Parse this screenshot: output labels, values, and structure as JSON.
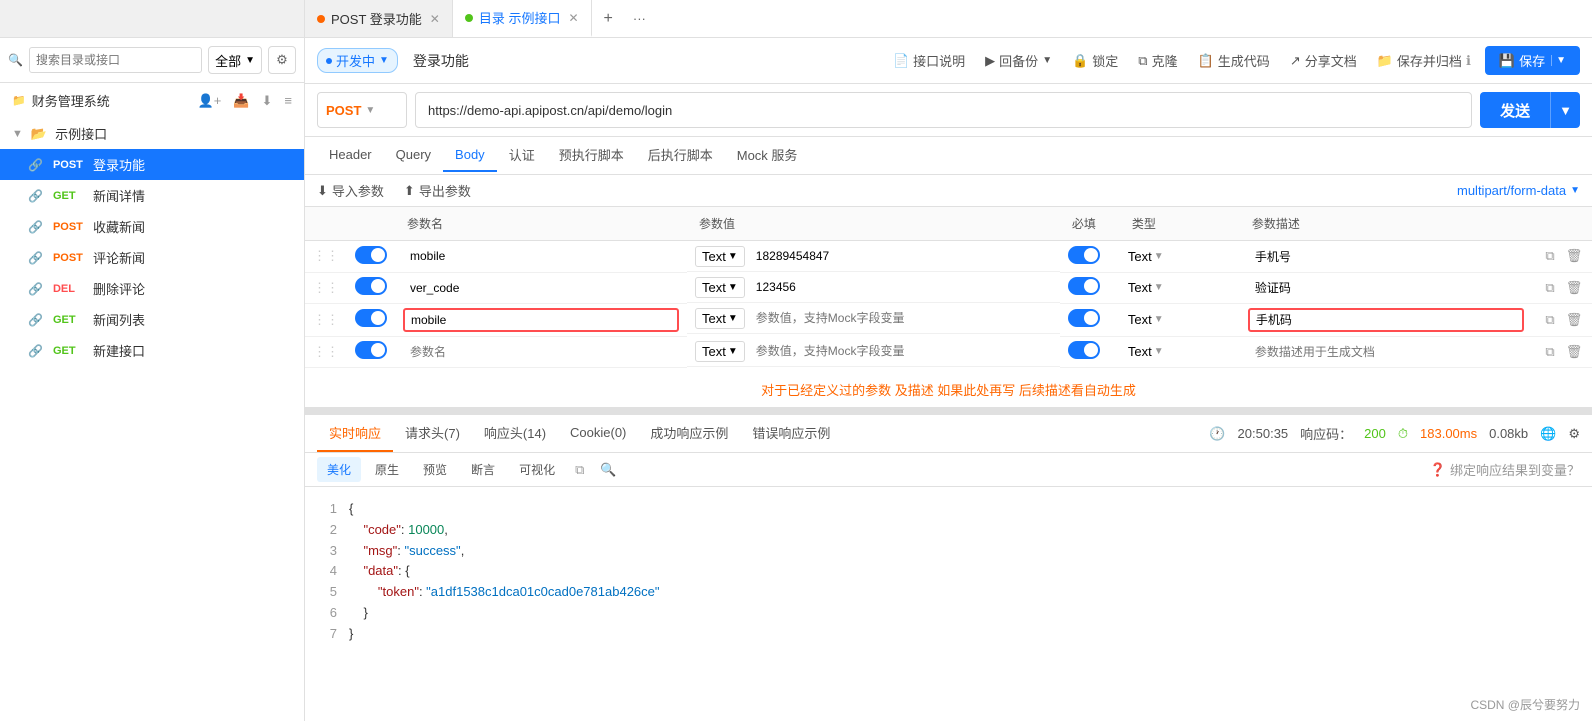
{
  "tabBar": {
    "tabs": [
      {
        "id": "post-login",
        "dot": "orange",
        "label": "POST 登录功能",
        "closable": true,
        "active": false
      },
      {
        "id": "example-api",
        "dot": "green",
        "label": "目录 示例接口",
        "closable": true,
        "active": true
      }
    ],
    "addLabel": "+",
    "moreLabel": "···"
  },
  "sidebar": {
    "searchPlaceholder": "搜索目录或接口",
    "searchSelectLabel": "全部",
    "projectTitle": "财务管理系统",
    "items": [
      {
        "id": "example-folder",
        "type": "folder",
        "label": "示例接口",
        "expanded": true
      },
      {
        "id": "post-login",
        "method": "POST",
        "label": "登录功能",
        "active": true
      },
      {
        "id": "get-news-detail",
        "method": "GET",
        "label": "新闻详情"
      },
      {
        "id": "post-collect-news",
        "method": "POST",
        "label": "收藏新闻"
      },
      {
        "id": "post-comment-news",
        "method": "POST",
        "label": "评论新闻"
      },
      {
        "id": "del-comment",
        "method": "DEL",
        "label": "删除评论"
      },
      {
        "id": "get-news-list",
        "method": "GET",
        "label": "新闻列表"
      },
      {
        "id": "get-new-api",
        "method": "GET",
        "label": "新建接口"
      }
    ]
  },
  "request": {
    "statusBadge": "开发中",
    "apiName": "登录功能",
    "toolbar": {
      "descLabel": "接口说明",
      "backupLabel": "回备份",
      "lockLabel": "锁定",
      "cloneLabel": "克隆",
      "codeLabel": "生成代码",
      "shareLabel": "分享文档",
      "saveArchiveLabel": "保存并归档",
      "saveLabel": "保存"
    },
    "method": "POST",
    "url": "https://demo-api.apipost.cn/api/demo/login",
    "tabs": [
      "Header",
      "Query",
      "Body",
      "认证",
      "预执行脚本",
      "后执行脚本",
      "Mock 服务"
    ],
    "activeTab": "Body",
    "bodyToolbar": {
      "importLabel": "导入参数",
      "exportLabel": "导出参数",
      "formatValue": "multipart/form-data"
    },
    "tableHeaders": [
      "参数名",
      "参数值",
      "必填",
      "类型",
      "参数描述"
    ],
    "params": [
      {
        "id": 1,
        "enabled": true,
        "name": "mobile",
        "textType": "Text",
        "value": "18289454847",
        "required": true,
        "type": "Text",
        "description": "手机号",
        "highlighted": false
      },
      {
        "id": 2,
        "enabled": true,
        "name": "ver_code",
        "textType": "Text",
        "value": "123456",
        "required": true,
        "type": "Text",
        "description": "验证码",
        "highlighted": false
      },
      {
        "id": 3,
        "enabled": true,
        "name": "mobile",
        "textType": "Text",
        "valuePlaceholder": "参数值，支持Mock字段变量",
        "required": true,
        "type": "Text",
        "description": "手机码",
        "highlighted": true,
        "nameHighlighted": true
      },
      {
        "id": 4,
        "enabled": true,
        "name": "",
        "namePlaceholder": "参数名",
        "textType": "Text",
        "valuePlaceholder": "参数值，支持Mock字段变量",
        "required": true,
        "type": "Text",
        "descriptionPlaceholder": "参数描述用于生成文档",
        "highlighted": false
      }
    ],
    "hintText": "对于已经定义过的参数 及描述 如果此处再写 后续描述看自动生成"
  },
  "response": {
    "tabs": [
      "实时响应",
      "请求头(7)",
      "响应头(14)",
      "Cookie(0)",
      "成功响应示例",
      "错误响应示例"
    ],
    "activeTab": "实时响应",
    "meta": {
      "time": "20:50:35",
      "statusCode": "200",
      "duration": "183.00ms",
      "size": "0.08kb"
    },
    "bodyTabs": [
      "美化",
      "原生",
      "预览",
      "断言",
      "可视化"
    ],
    "activeBodyTab": "美化",
    "bindLabel": "绑定响应结果到变量？",
    "code": [
      {
        "line": 1,
        "content": "{"
      },
      {
        "line": 2,
        "key": "code",
        "value": "10000",
        "type": "num"
      },
      {
        "line": 3,
        "key": "msg",
        "value": "\"success\"",
        "type": "str"
      },
      {
        "line": 4,
        "key": "data",
        "value": "{",
        "type": "obj-open"
      },
      {
        "line": 5,
        "key": "token",
        "value": "\"a1df1538c1dca01c0cad0e781ab426ce\"",
        "type": "str",
        "indent": true
      },
      {
        "line": 6,
        "content": "    }"
      },
      {
        "line": 7,
        "content": "}"
      }
    ]
  },
  "watermark": "CSDN @辰兮要努力"
}
